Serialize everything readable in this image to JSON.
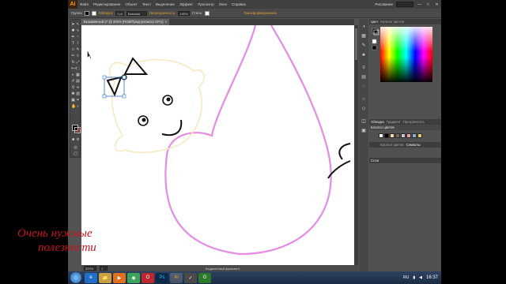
{
  "app": {
    "logo": "Ai"
  },
  "menubar": {
    "items": [
      "Файл",
      "Редактирование",
      "Объект",
      "Текст",
      "Выделение",
      "Эффект",
      "Просмотр",
      "Окно",
      "Справка"
    ],
    "workspace": "Рисование",
    "window_controls": [
      "—",
      "□",
      "✕"
    ]
  },
  "controlbar": {
    "group_label": "Группа",
    "stroke_label": "Обводка:",
    "stroke_value": "1 pt",
    "uniform": "Базовая",
    "opacity_label": "Непрозрачность:",
    "opacity_value": "100%",
    "style_label": "Стиль:",
    "transform_link": "Трансформирование"
  },
  "document": {
    "tab_title": "Безымянный-2* @ 200% (RGB/Предпросмотр GPU)",
    "tab_close": "×"
  },
  "statusbar": {
    "zoom": "200%",
    "page": "1",
    "tool_label": "Выделенный фрагмент"
  },
  "panels": {
    "color_tabs": [
      "Цвет",
      "Каталог цветов"
    ],
    "stroke_tabs": [
      "Обводка",
      "Градиент",
      "Прозрачность"
    ],
    "swatch_tabs": [
      "Каталог цветов",
      "Символы"
    ],
    "layers_tab": "Слои",
    "swatch_colors": [
      "#ffffff",
      "#000000",
      "#f0d8b8",
      "#7a6a5a",
      "#c8c8c8",
      "#e6a0a0",
      "#8fb0d0",
      "#e0d060"
    ]
  },
  "taskbar": {
    "apps": [
      "ie-icon",
      "explorer-icon",
      "player-icon",
      "chrome-icon",
      "opera-icon",
      "photoshop-icon",
      "illustrator-icon",
      "nvidia-icon",
      "greenshot-icon"
    ],
    "app_labels": [
      "e",
      "📁",
      "▶",
      "◉",
      "O",
      "Ps",
      "Ai",
      "✓",
      "G"
    ],
    "tray_lang": "RU",
    "clock": "16:37"
  },
  "watermark": {
    "line1": "Очень нужные",
    "line2": "полезности"
  },
  "colors": {
    "bear_outline": "#f6e8c0",
    "body_outline": "#e48ce4",
    "ink": "#111111",
    "selection": "#2a6fc8"
  }
}
